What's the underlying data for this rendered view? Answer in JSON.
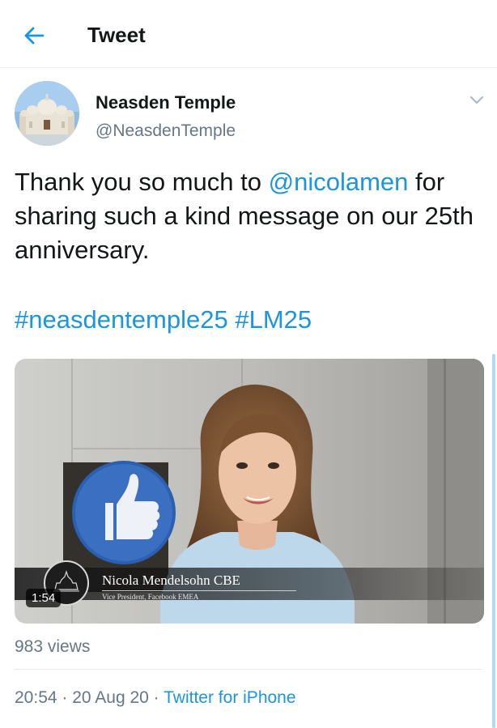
{
  "header": {
    "title": "Tweet",
    "back_icon": "arrow-left-icon"
  },
  "author": {
    "display_name": "Neasden Temple",
    "handle": "@NeasdenTemple"
  },
  "tweet": {
    "text_before": "Thank you so much to ",
    "mention": "@nicolamen",
    "text_after": " for sharing such a kind message on our 25th anniversary.",
    "hashtag_1": "#neasdentemple25",
    "hashtag_2": "#LM25"
  },
  "video": {
    "lower_third_name": "Nicola Mendelsohn CBE",
    "lower_third_subtitle": "Vice President, Facebook EMEA",
    "duration": "1:54"
  },
  "stats": {
    "views": "983 views"
  },
  "meta": {
    "time": "20:54",
    "date": "20 Aug 20",
    "source": "Twitter for iPhone",
    "separator": " · "
  },
  "colors": {
    "accent": "#1b95e0",
    "secondary_text": "#657786",
    "divider": "#e6ecf0"
  }
}
